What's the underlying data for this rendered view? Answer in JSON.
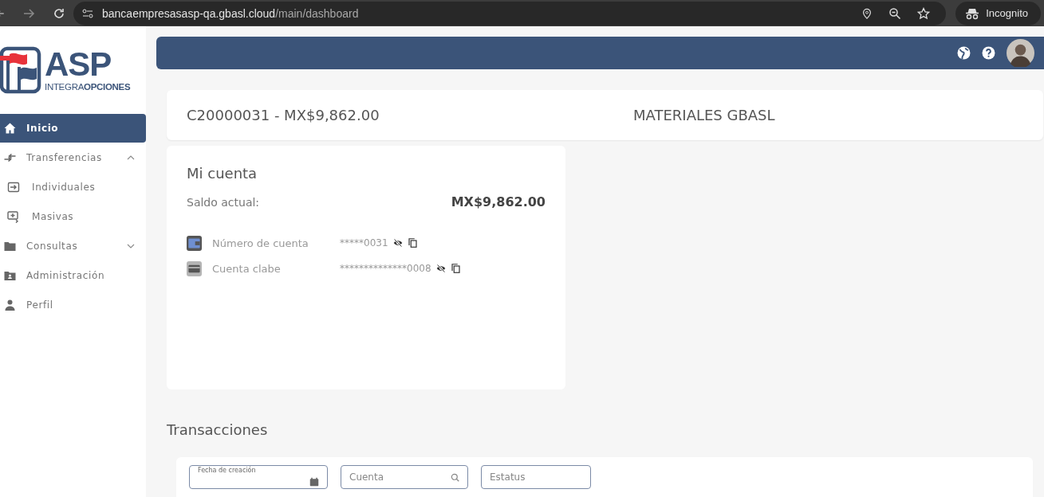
{
  "browser": {
    "url_host": "bancaempresasasp-qa.gbasl.cloud",
    "url_path": "/main/dashboard",
    "profile": "Incognito"
  },
  "logo": {
    "name": "ASP",
    "tagline_light": "INTEGRA",
    "tagline_bold": "OPCIONES"
  },
  "sidebar": {
    "items": [
      {
        "kind": "home",
        "label": "Inicio",
        "selected": true
      },
      {
        "kind": "transfer",
        "label": "Transferencias",
        "selected": false,
        "expanded": true,
        "children": [
          {
            "kind": "login",
            "label": "Individuales",
            "selected": false
          },
          {
            "kind": "bulk",
            "label": "Masivas",
            "selected": false
          }
        ]
      },
      {
        "kind": "folder",
        "label": "Consultas",
        "selected": false,
        "expanded": false
      },
      {
        "kind": "admin",
        "label": "Administración",
        "selected": false
      },
      {
        "kind": "person",
        "label": "Perfil",
        "selected": false
      }
    ]
  },
  "account_bar": {
    "account": "C20000031 - MX$9,862.00",
    "company": "MATERIALES GBASL"
  },
  "my_account": {
    "title": "Mi cuenta",
    "balance_label": "Saldo actual:",
    "balance": "MX$9,862.00",
    "rows": [
      {
        "kind": "wallet",
        "label": "Número de cuenta",
        "value": "*****0031"
      },
      {
        "kind": "card",
        "label": "Cuenta clabe",
        "value": "**************0008"
      }
    ]
  },
  "transactions": {
    "title": "Transacciones",
    "filters": [
      {
        "kind": "date",
        "label": "Fecha de creación"
      },
      {
        "kind": "search",
        "placeholder": "Cuenta"
      },
      {
        "kind": "select",
        "placeholder": "Estatus"
      }
    ]
  }
}
